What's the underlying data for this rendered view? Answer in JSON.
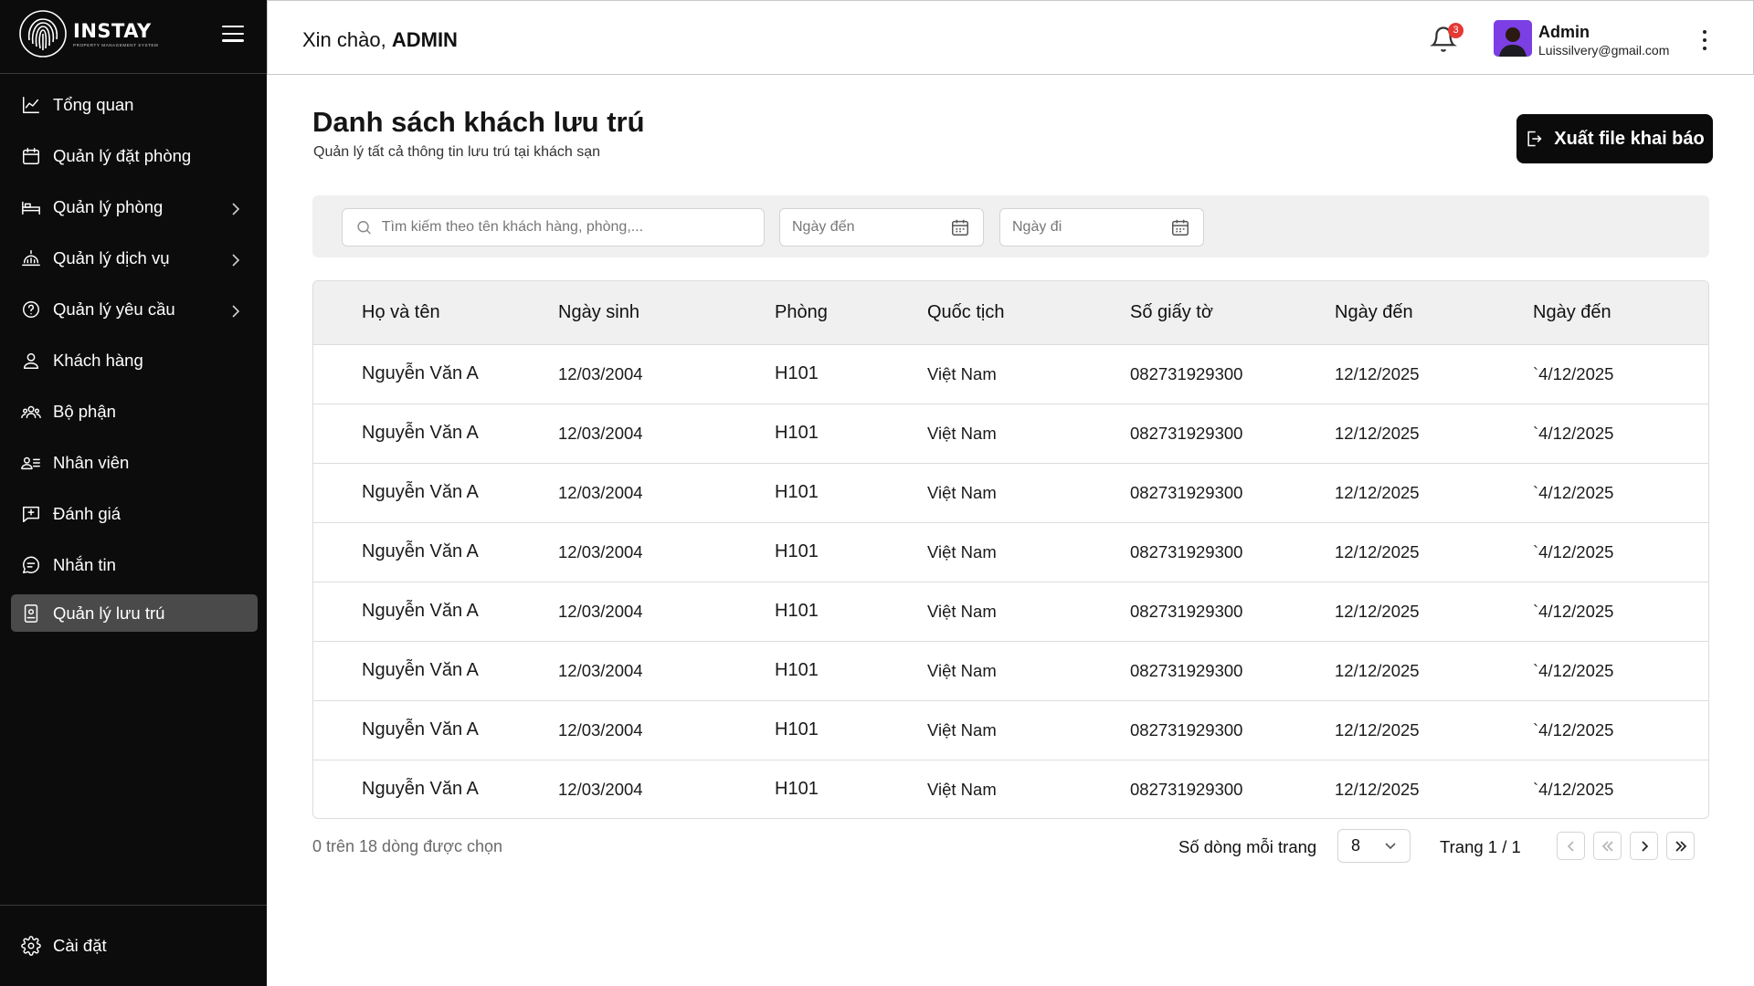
{
  "brand": {
    "name": "INSTAY",
    "tagline": "PROPERTY MANAGEMENT SYSTEM"
  },
  "sidebar": {
    "items": [
      {
        "label": "Tổng quan",
        "icon": "chart-line-icon",
        "has_submenu": false
      },
      {
        "label": "Quản lý đặt phòng",
        "icon": "calendar-icon",
        "has_submenu": false
      },
      {
        "label": "Quản lý phòng",
        "icon": "bed-icon",
        "has_submenu": true
      },
      {
        "label": "Quản lý dịch vụ",
        "icon": "service-bell-icon",
        "has_submenu": true
      },
      {
        "label": "Quản lý yêu cầu",
        "icon": "help-circle-icon",
        "has_submenu": true
      },
      {
        "label": "Khách hàng",
        "icon": "user-icon",
        "has_submenu": false
      },
      {
        "label": "Bộ phận",
        "icon": "team-icon",
        "has_submenu": false
      },
      {
        "label": "Nhân viên",
        "icon": "staff-list-icon",
        "has_submenu": false
      },
      {
        "label": "Đánh giá",
        "icon": "review-icon",
        "has_submenu": false
      },
      {
        "label": "Nhắn tin",
        "icon": "chat-icon",
        "has_submenu": false
      },
      {
        "label": "Quản lý lưu trú",
        "icon": "badge-id-icon",
        "has_submenu": false,
        "active": true
      }
    ],
    "settings_label": "Cài đặt"
  },
  "header": {
    "greeting_prefix": "Xin chào, ",
    "greeting_name": "ADMIN",
    "notification_count": "3",
    "user_name": "Admin",
    "user_email": "Luissilvery@gmail.com"
  },
  "main": {
    "title": "Danh sách khách lưu trú",
    "subtitle": "Quản lý tất cả thông tin lưu trú tại khách sạn",
    "export_label": "Xuất file khai báo",
    "filters": {
      "search_placeholder": "Tìm kiếm theo tên khách hàng, phòng,...",
      "arrival_placeholder": "Ngày đến",
      "departure_placeholder": "Ngày đi"
    },
    "table": {
      "columns": [
        "Họ và tên",
        "Ngày sinh",
        "Phòng",
        "Quốc tịch",
        "Số giấy tờ",
        "Ngày đến",
        "Ngày đến"
      ],
      "rows": [
        [
          "Nguyễn Văn A",
          "12/03/2004",
          "H101",
          "Việt Nam",
          "082731929300",
          "12/12/2025",
          "`4/12/2025"
        ],
        [
          "Nguyễn Văn A",
          "12/03/2004",
          "H101",
          "Việt Nam",
          "082731929300",
          "12/12/2025",
          "`4/12/2025"
        ],
        [
          "Nguyễn Văn A",
          "12/03/2004",
          "H101",
          "Việt Nam",
          "082731929300",
          "12/12/2025",
          "`4/12/2025"
        ],
        [
          "Nguyễn Văn A",
          "12/03/2004",
          "H101",
          "Việt Nam",
          "082731929300",
          "12/12/2025",
          "`4/12/2025"
        ],
        [
          "Nguyễn Văn A",
          "12/03/2004",
          "H101",
          "Việt Nam",
          "082731929300",
          "12/12/2025",
          "`4/12/2025"
        ],
        [
          "Nguyễn Văn A",
          "12/03/2004",
          "H101",
          "Việt Nam",
          "082731929300",
          "12/12/2025",
          "`4/12/2025"
        ],
        [
          "Nguyễn Văn A",
          "12/03/2004",
          "H101",
          "Việt Nam",
          "082731929300",
          "12/12/2025",
          "`4/12/2025"
        ],
        [
          "Nguyễn Văn A",
          "12/03/2004",
          "H101",
          "Việt Nam",
          "082731929300",
          "12/12/2025",
          "`4/12/2025"
        ]
      ]
    },
    "footer": {
      "selected_info": "0 trên 18 dòng được chọn",
      "rows_per_page_label": "Số dòng mỗi trang",
      "rows_per_page_value": "8",
      "page_info": "Trang 1 / 1"
    }
  },
  "colors": {
    "sidebar_bg": "#0c0c0c",
    "active_item_bg": "#4a4a4a",
    "primary_button": "#0b0b0b",
    "badge": "#e53935",
    "avatar_bg": "#7b3fe4"
  }
}
